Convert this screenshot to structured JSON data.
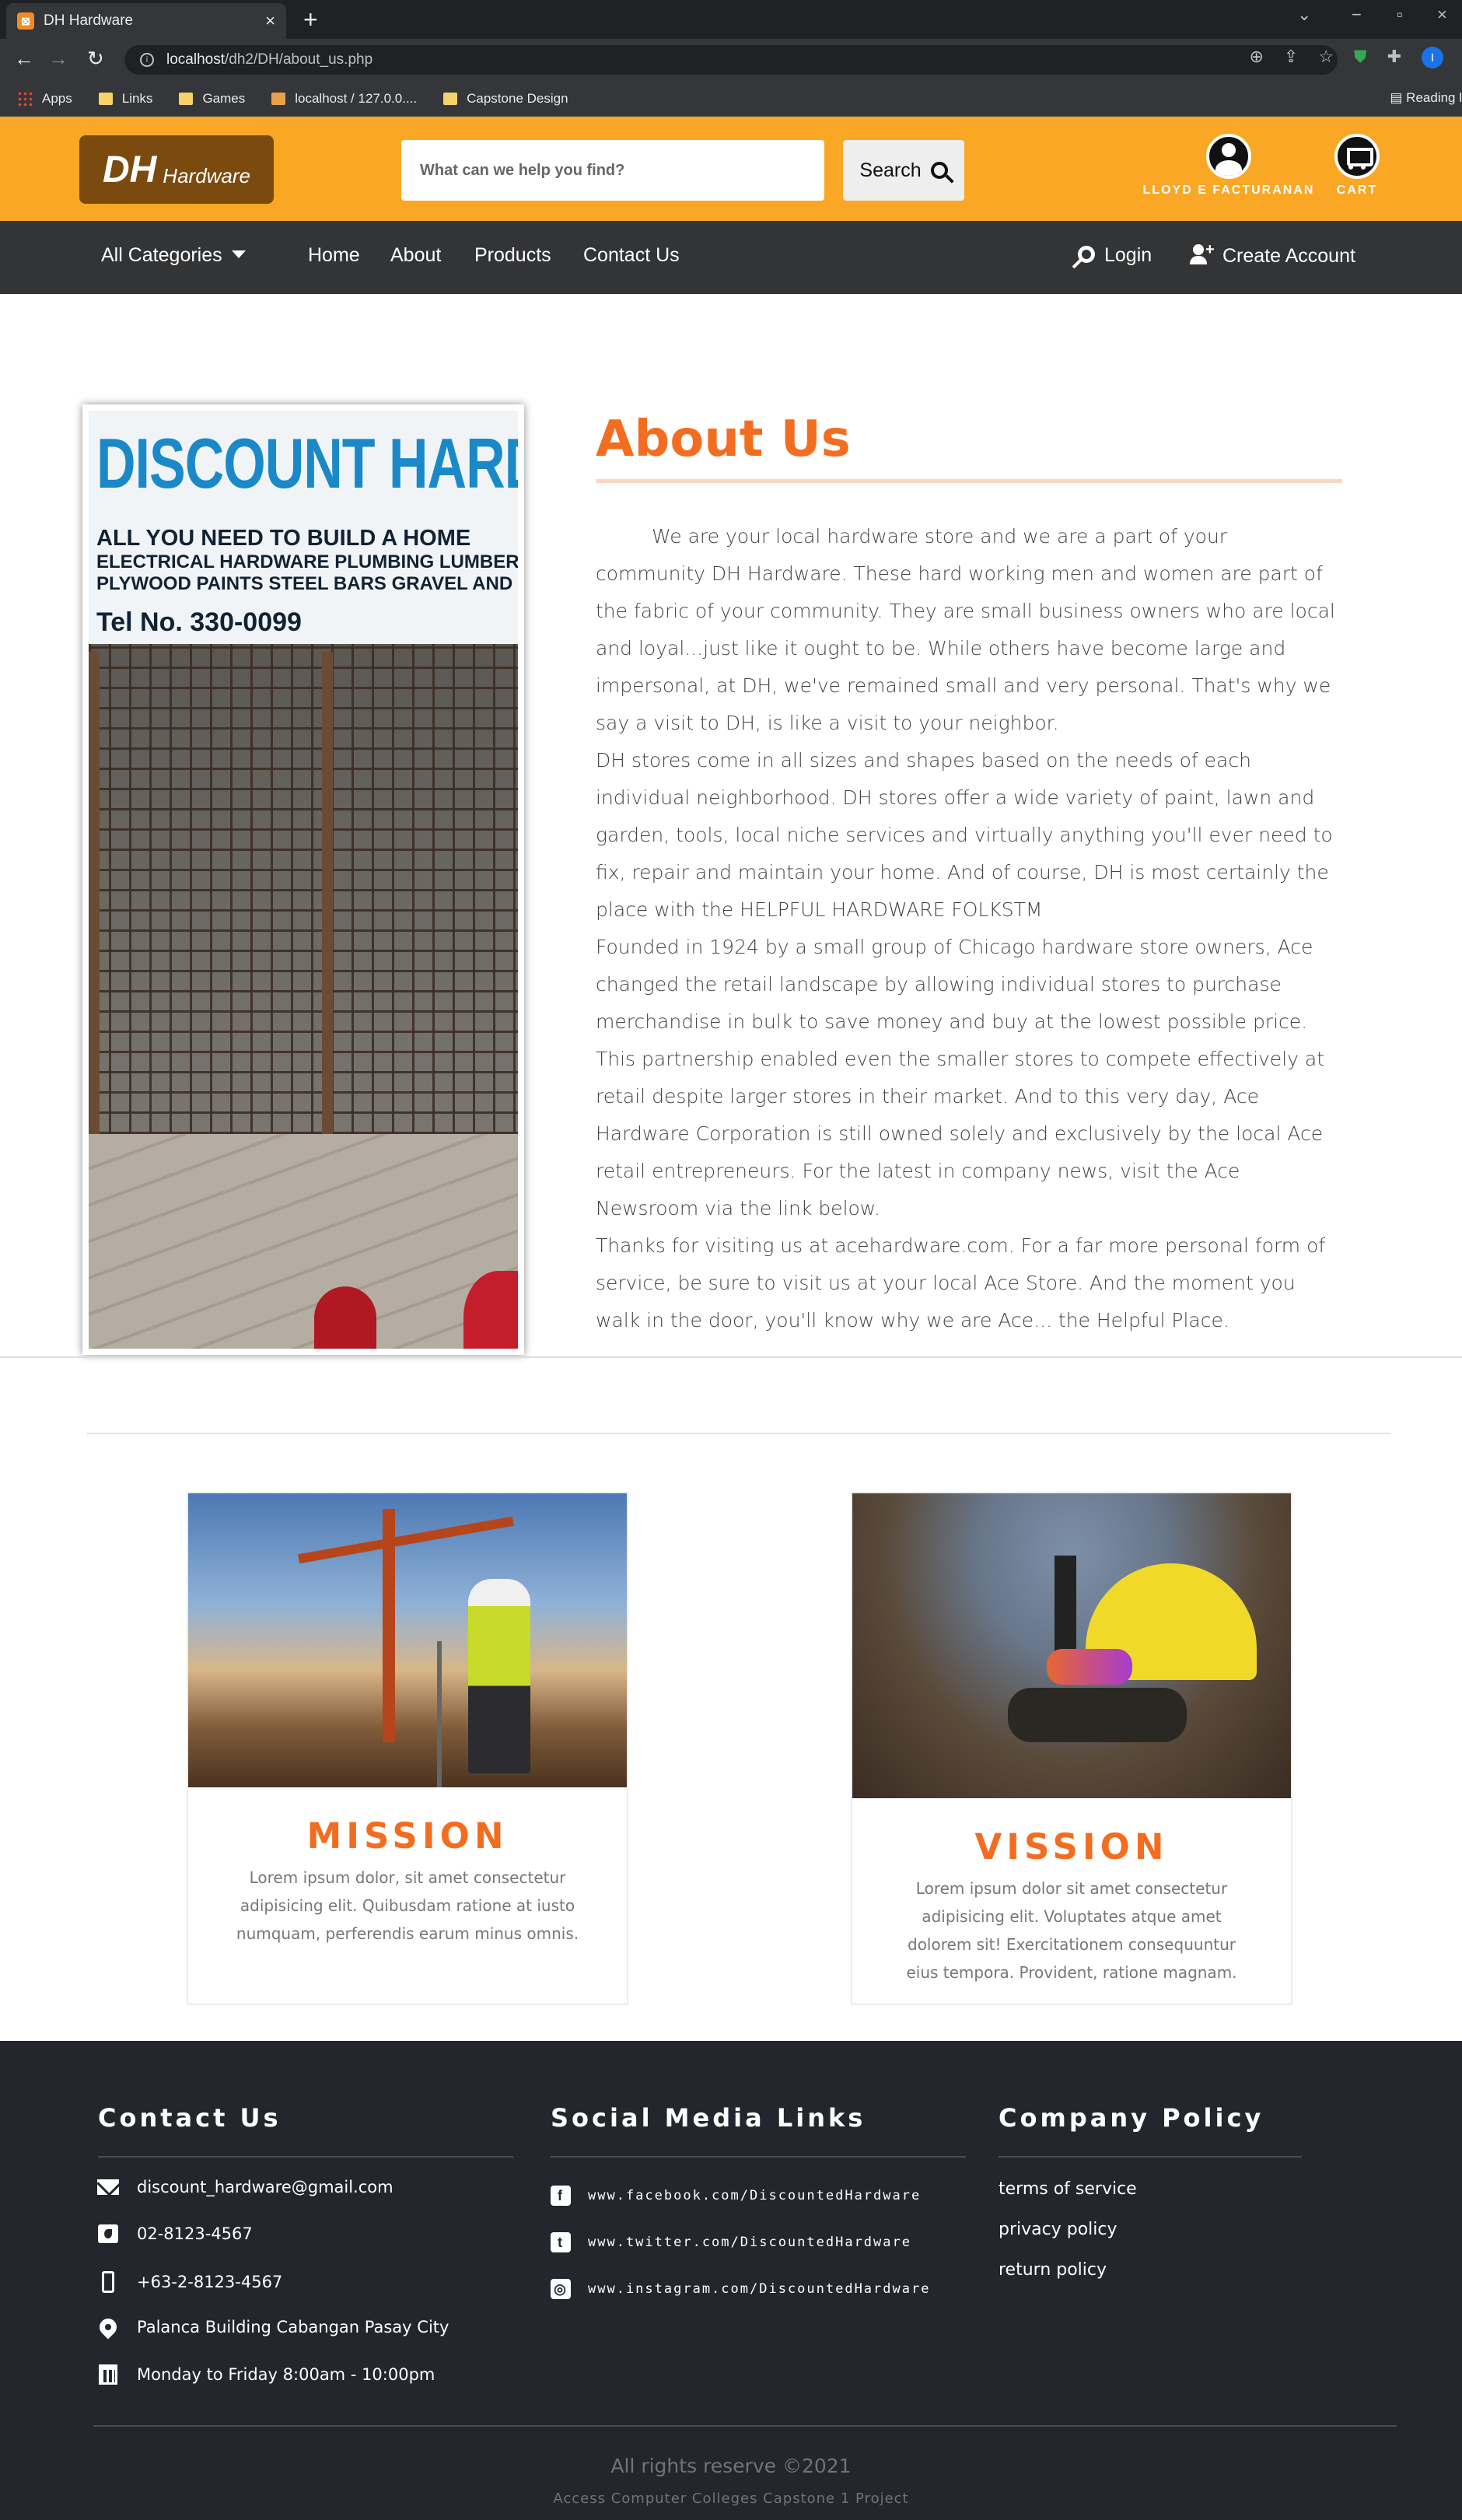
{
  "browser": {
    "tab_title": "DH Hardware",
    "url_host": "localhost",
    "url_path": "/dh2/DH/about_us.php",
    "bookmarks": [
      "Apps",
      "Links",
      "Games",
      "localhost / 127.0.0....",
      "Capstone Design"
    ],
    "reading_list": "Reading l",
    "profile_initial": "I"
  },
  "header": {
    "logo_main": "DH",
    "logo_sub": "Hardware",
    "search_placeholder": "What can we help you find?",
    "search_button": "Search",
    "user_name": "LLOYD E FACTURANAN",
    "cart_label": "CART",
    "brand_color": "#f9a725"
  },
  "nav": {
    "categories": "All Categories",
    "links": [
      "Home",
      "About",
      "Products",
      "Contact Us"
    ],
    "login": "Login",
    "create_account": "Create Account"
  },
  "photo_sign": {
    "title": "DISCOUNT HARDWARE",
    "line1": "ALL YOU NEED TO BUILD A HOME",
    "line2": "ELECTRICAL HARDWARE PLUMBING LUMBER",
    "line3": "PLYWOOD PAINTS STEEL BARS GRAVEL AND SAND",
    "tel": "Tel No. 330-0099"
  },
  "about": {
    "title": "About Us",
    "paragraphs": [
      "We are your local hardware store and we are a part of your community DH Hardware. These hard working men and women are part of the fabric of your community. They are small business owners who are local and loyal...just like it ought to be. While others have become large and impersonal, at DH, we've remained small and very personal. That's why we say a visit to DH, is like a visit to your neighbor.",
      "DH stores come in all sizes and shapes based on the needs of each individual neighborhood. DH stores offer a wide variety of paint, lawn and garden, tools, local niche services and virtually anything you'll ever need to fix, repair and maintain your home. And of course, DH is most certainly the place with the HELPFUL HARDWARE FOLKSTM",
      "Founded in 1924 by a small group of Chicago hardware store owners, Ace changed the retail landscape by allowing individual stores to purchase merchandise in bulk to save money and buy at the lowest possible price. This partnership enabled even the smaller stores to compete effectively at retail despite larger stores in their market. And to this very day, Ace Hardware Corporation is still owned solely and exclusively by the local Ace retail entrepreneurs. For the latest in company news, visit the Ace Newsroom via the link below.",
      "Thanks for visiting us at acehardware.com. For a far more personal form of service, be sure to visit us at your local Ace Store. And the moment you walk in the door, you'll know why we are Ace... the Helpful Place."
    ],
    "accent_color": "#f36d21"
  },
  "cards": [
    {
      "title": "MISSION",
      "text": "Lorem ipsum dolor, sit amet consectetur adipisicing elit. Quibusdam ratione at iusto numquam, perferendis earum minus omnis."
    },
    {
      "title": "VISSION",
      "text": "Lorem ipsum dolor sit amet consectetur adipisicing elit. Voluptates atque amet dolorem sit! Exercitationem consequuntur eius tempora. Provident, ratione magnam."
    }
  ],
  "footer": {
    "contact_title": "Contact Us",
    "contact_items": [
      {
        "icon": "envelope-icon",
        "text": "discount_hardware@gmail.com"
      },
      {
        "icon": "phone-icon",
        "text": "02-8123-4567"
      },
      {
        "icon": "mobile-icon",
        "text": "+63-2-8123-4567"
      },
      {
        "icon": "map-pin-icon",
        "text": "Palanca Building Cabangan Pasay City"
      },
      {
        "icon": "calendar-icon",
        "text": "Monday to Friday 8:00am - 10:00pm"
      }
    ],
    "social_title": "Social Media Links",
    "social_items": [
      {
        "icon": "facebook-icon",
        "text": "www.facebook.com/DiscountedHardware"
      },
      {
        "icon": "twitter-icon",
        "text": "www.twitter.com/DiscountedHardware"
      },
      {
        "icon": "instagram-icon",
        "text": "www.instagram.com/DiscountedHardware"
      }
    ],
    "policy_title": "Company Policy",
    "policy_items": [
      "terms of service",
      "privacy policy",
      "return policy"
    ],
    "rights": "All rights reserve ©2021",
    "credit": "Access Computer Colleges Capstone 1 Project",
    "background": "#23262c"
  }
}
